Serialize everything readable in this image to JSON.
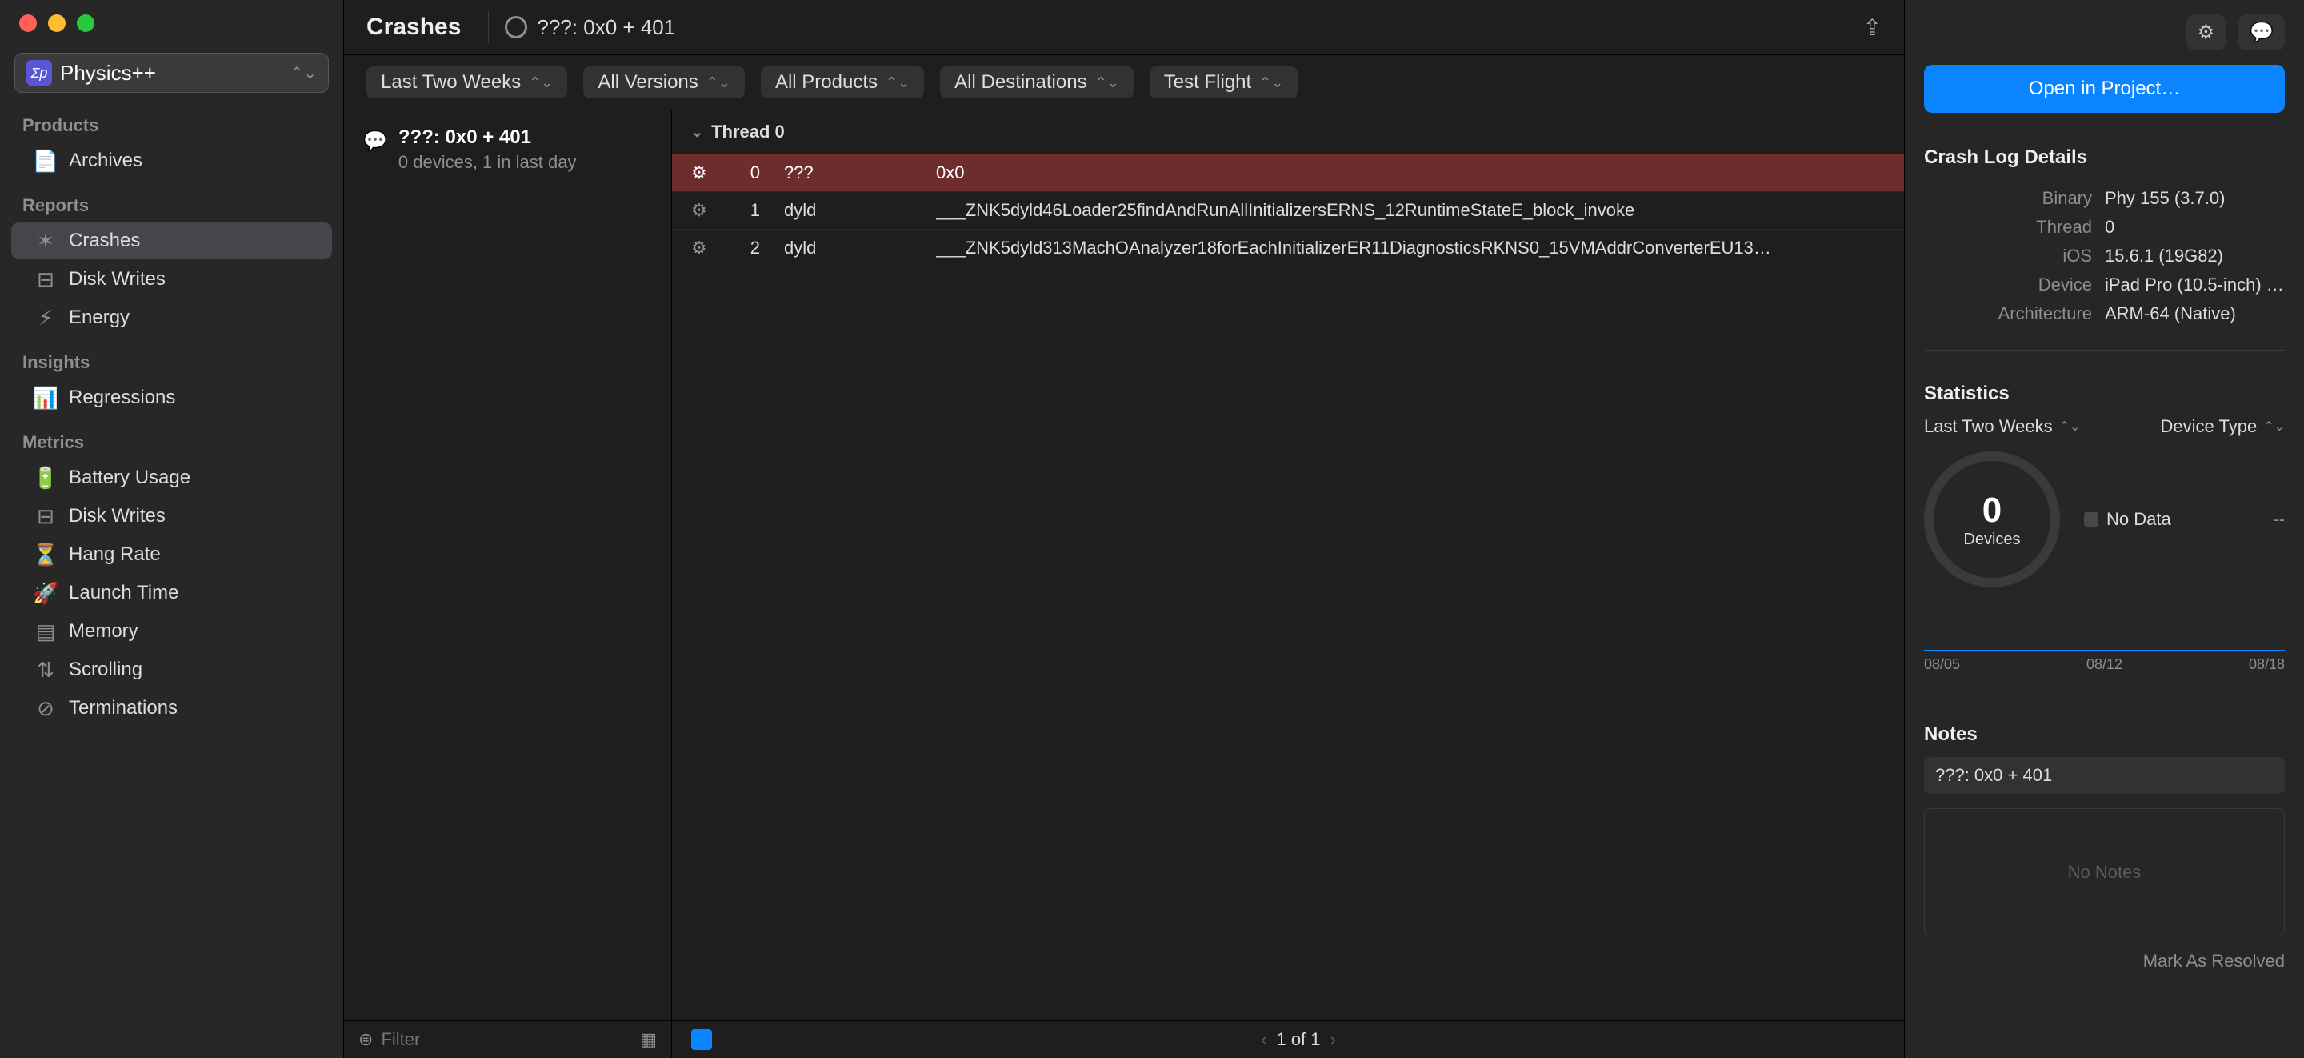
{
  "project": {
    "name": "Physics++",
    "icon_text": "Σp"
  },
  "sidebar": {
    "sections": [
      {
        "title": "Products",
        "items": [
          {
            "icon": "📄",
            "label": "Archives"
          }
        ]
      },
      {
        "title": "Reports",
        "items": [
          {
            "icon": "✶",
            "label": "Crashes",
            "selected": true
          },
          {
            "icon": "⊟",
            "label": "Disk Writes"
          },
          {
            "icon": "⚡︎",
            "label": "Energy"
          }
        ]
      },
      {
        "title": "Insights",
        "items": [
          {
            "icon": "📊",
            "label": "Regressions"
          }
        ]
      },
      {
        "title": "Metrics",
        "items": [
          {
            "icon": "🔋",
            "label": "Battery Usage"
          },
          {
            "icon": "⊟",
            "label": "Disk Writes"
          },
          {
            "icon": "⏳",
            "label": "Hang Rate"
          },
          {
            "icon": "🚀",
            "label": "Launch Time"
          },
          {
            "icon": "▤",
            "label": "Memory"
          },
          {
            "icon": "⇅",
            "label": "Scrolling"
          },
          {
            "icon": "⊘",
            "label": "Terminations"
          }
        ]
      }
    ]
  },
  "header": {
    "page_title": "Crashes",
    "location": "???: 0x0 + 401"
  },
  "filters": [
    {
      "label": "Last Two Weeks"
    },
    {
      "label": "All Versions"
    },
    {
      "label": "All Products"
    },
    {
      "label": "All Destinations"
    },
    {
      "label": "Test Flight"
    }
  ],
  "crash_list": {
    "items": [
      {
        "title": "???: 0x0 + 401",
        "meta": "0 devices, 1 in last day"
      }
    ],
    "filter_placeholder": "Filter"
  },
  "thread": {
    "header": "Thread 0",
    "frames": [
      {
        "num": "0",
        "module": "???",
        "symbol": "0x0",
        "selected": true
      },
      {
        "num": "1",
        "module": "dyld",
        "symbol": "___ZNK5dyld46Loader25findAndRunAllInitializersERNS_12RuntimeStateE_block_invoke"
      },
      {
        "num": "2",
        "module": "dyld",
        "symbol": "___ZNK5dyld313MachOAnalyzer18forEachInitializerER11DiagnosticsRKNS0_15VMAddrConverterEU13…"
      }
    ]
  },
  "pager": {
    "text": "1 of 1"
  },
  "inspector": {
    "open_button": "Open in Project…",
    "details_title": "Crash Log Details",
    "details": {
      "Binary": "Phy 155 (3.7.0)",
      "Thread": "0",
      "iOS": "15.6.1 (19G82)",
      "Device": "iPad Pro (10.5-inch) (…",
      "Architecture": "ARM-64 (Native)"
    },
    "stats_title": "Statistics",
    "stats_period": "Last Two Weeks",
    "stats_group": "Device Type",
    "donut_value": "0",
    "donut_label": "Devices",
    "legend_label": "No Data",
    "legend_value": "--",
    "xlabels": [
      "08/05",
      "08/12",
      "08/18"
    ],
    "notes_title": "Notes",
    "note_name": "???: 0x0 + 401",
    "no_notes": "No Notes",
    "resolve": "Mark As Resolved"
  }
}
